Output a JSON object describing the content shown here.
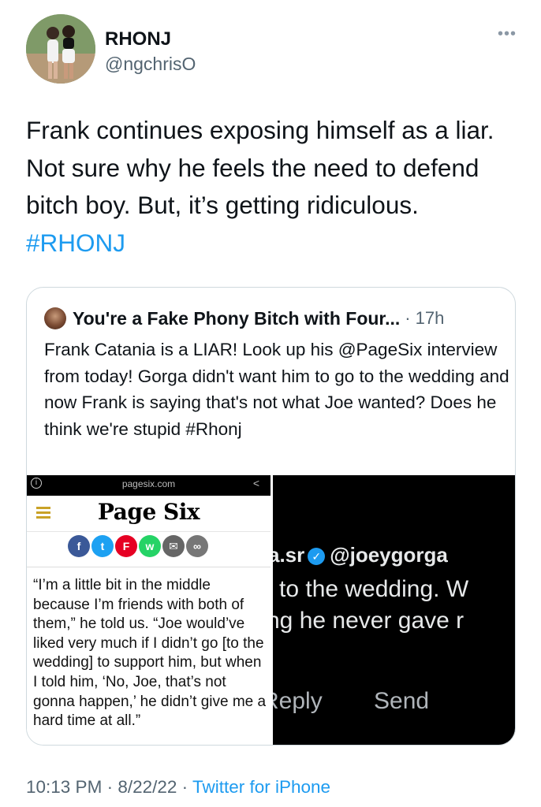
{
  "author": {
    "display_name": "RHONJ",
    "handle": "@ngchrisO"
  },
  "tweet": {
    "text": "Frank continues exposing himself as a liar. Not sure why he feels the need to defend bitch boy. But, it’s getting ridiculous. ",
    "hashtag": "#RHONJ"
  },
  "more_icon": "more-horizontal-icon",
  "quoted": {
    "display_name": "You're a Fake Phony Bitch with Four...",
    "separator": "·",
    "time": "17h",
    "text": "Frank Catania is a LIAR! Look up his @PageSix interview from today! Gorga didn't want him to go to the wedding and now Frank is saying that's not what Joe wanted? Does he think we're stupid #Rhonj",
    "media_left": {
      "url": "pagesix.com",
      "logo": "Page Six",
      "body": "“I’m a little bit in the middle because I’m friends with both of them,” he told us. “Joe would’ve liked very much if I didn’t go [to the wedding] to support him, but when I told him, ‘No, Joe, that’s not gonna happen,’ he didn’t give me a hard time at all.”",
      "share_colors": [
        "#3b5998",
        "#1da1f2",
        "#e60023",
        "#25d366",
        "#666666",
        "#777777"
      ]
    },
    "media_right": {
      "line1_prefix": "a.sr",
      "line1_mention": "@joeygorga",
      "line2": "to the wedding. W",
      "line3": "ng he never gave r",
      "reply_label": "Reply",
      "send_label": "Send"
    }
  },
  "meta": {
    "time": "10:13 PM",
    "sep1": " · ",
    "date": "8/22/22",
    "sep2": " · ",
    "source": "Twitter for iPhone"
  }
}
